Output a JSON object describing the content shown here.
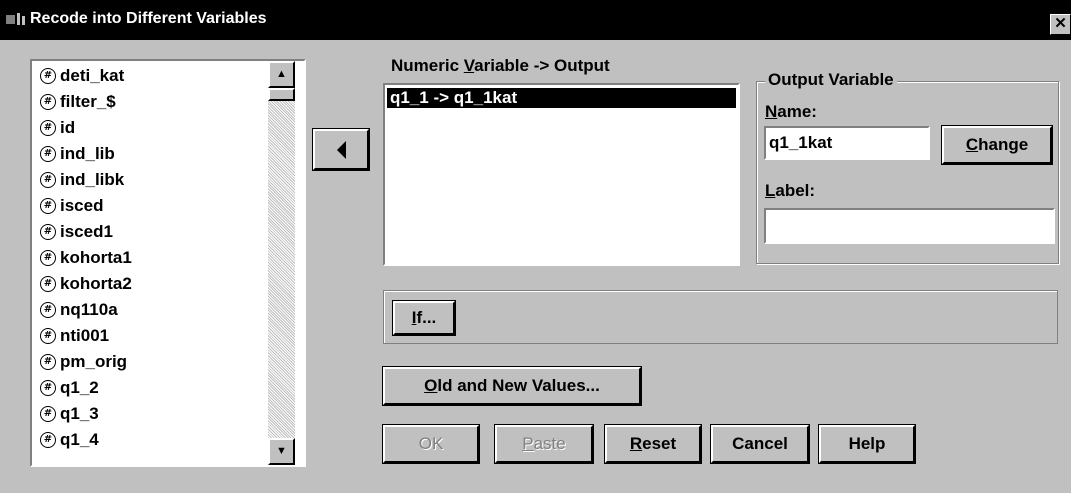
{
  "window": {
    "title": "Recode into Different Variables",
    "close_glyph": "✕"
  },
  "variables": [
    "deti_kat",
    "filter_$",
    "id",
    "ind_lib",
    "ind_libk",
    "isced",
    "isced1",
    "kohorta1",
    "kohorta2",
    "nq110a",
    "nti001",
    "pm_orig",
    "q1_2",
    "q1_3",
    "q1_4"
  ],
  "variable_icon": "numeric-variable-icon",
  "mapping": {
    "label_pre": "Numeric ",
    "label_mnemonic": "V",
    "label_post": "ariable -> Output",
    "items": [
      "q1_1 -> q1_1kat"
    ]
  },
  "output_variable": {
    "group_title": "Output Variable",
    "name_mnemonic": "N",
    "name_rest": "ame:",
    "name_value": "q1_1kat",
    "label_mnemonic": "L",
    "label_rest": "abel:",
    "label_value": "",
    "change_mnemonic": "C",
    "change_rest": "hange"
  },
  "buttons": {
    "if_mnemonic": "I",
    "if_rest": "f...",
    "old_new_mnemonic": "O",
    "old_new_rest": "ld and New Values...",
    "ok": "OK",
    "paste_mnemonic": "P",
    "paste_rest": "aste",
    "reset_mnemonic": "R",
    "reset_rest": "eset",
    "cancel": "Cancel",
    "help": "Help"
  },
  "colors": {
    "face": "#c0c0c0",
    "titlebar": "#000000",
    "selection": "#000000",
    "disabled_text": "#808080"
  }
}
